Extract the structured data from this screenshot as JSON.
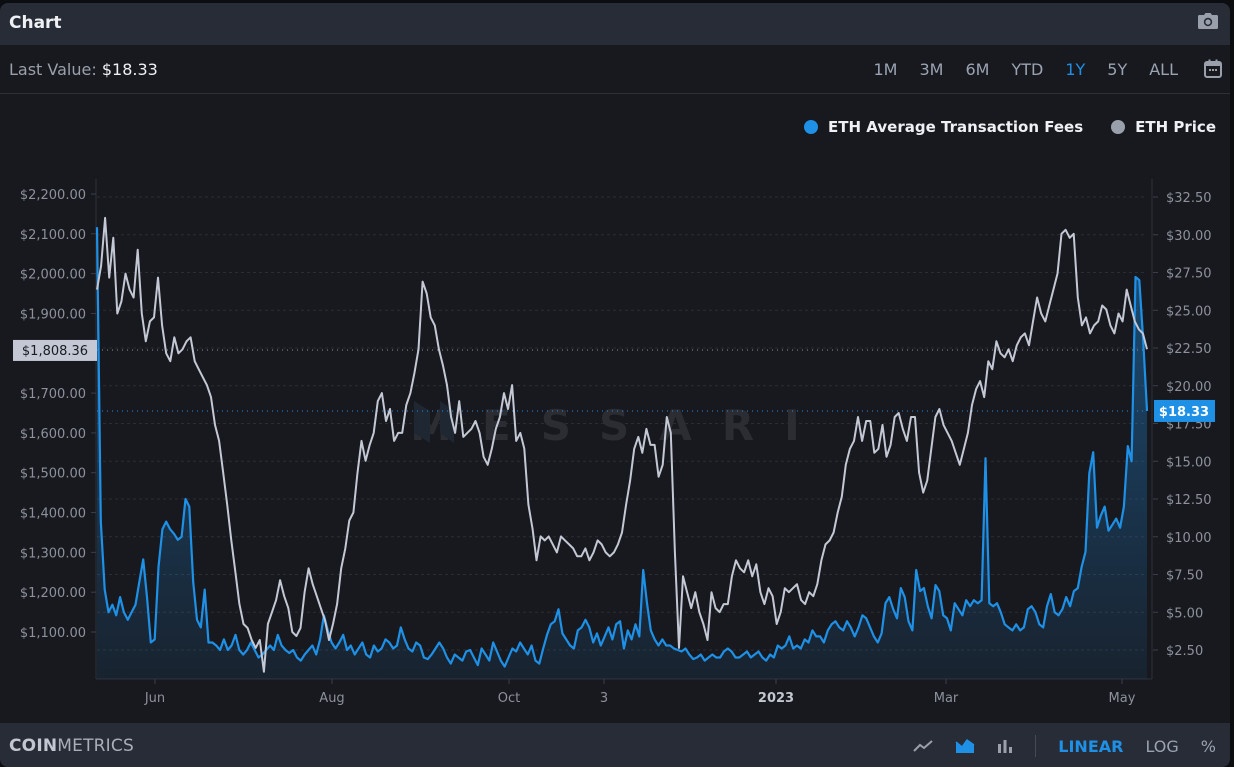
{
  "header": {
    "title": "Chart",
    "camera_icon": "camera-icon"
  },
  "subbar": {
    "last_value_label": "Last Value:",
    "last_value": "$18.33",
    "ranges": [
      "1M",
      "3M",
      "6M",
      "YTD",
      "1Y",
      "5Y",
      "ALL"
    ],
    "active_range": "1Y",
    "calendar_icon": "calendar-icon"
  },
  "footer": {
    "brand_bold": "COIN",
    "brand_light": "METRICS",
    "chart_types": [
      "line-chart-icon",
      "area-chart-icon",
      "bar-chart-icon"
    ],
    "active_chart_type": "area-chart-icon",
    "scale_modes": [
      "LINEAR",
      "LOG",
      "%"
    ],
    "active_scale": "LINEAR"
  },
  "colors": {
    "fees": "#1e90e6",
    "price": "#c3c8d4",
    "accent": "#1e90e6",
    "price_legend_dot": "#9aa0ab"
  },
  "watermark": "MESSARI",
  "chart_data": {
    "type": "line",
    "title": "",
    "legend": [
      "ETH Average Transaction Fees",
      "ETH Price"
    ],
    "legend_position": "top-right",
    "x_ticks": [
      "Jun",
      "Aug",
      "Oct",
      "3",
      "2023",
      "Mar",
      "May"
    ],
    "x_range": [
      "2022-05-21",
      "2023-05-10"
    ],
    "left_axis": {
      "series": "ETH Price",
      "ticks": [
        "$2,200.00",
        "$2,100.00",
        "$2,000.00",
        "$1,900.00",
        "$1,700.00",
        "$1,600.00",
        "$1,500.00",
        "$1,400.00",
        "$1,300.00",
        "$1,200.00",
        "$1,100.00"
      ],
      "range": [
        1000,
        2230
      ],
      "crosshair_label": "$1,808.36",
      "crosshair_value": 1808.36
    },
    "right_axis": {
      "series": "ETH Average Transaction Fees",
      "ticks": [
        "$32.50",
        "$30.00",
        "$27.50",
        "$25.00",
        "$22.50",
        "$20.00",
        "$17.50",
        "$15.00",
        "$12.50",
        "$10.00",
        "$7.50",
        "$5.00",
        "$2.50"
      ],
      "range": [
        0.6,
        33.5
      ],
      "last_label": "$18.33",
      "last_value": 18.33
    },
    "grid": true,
    "series": [
      {
        "name": "ETH Price",
        "axis": "left",
        "values": [
          1960,
          2020,
          2140,
          1990,
          2090,
          1900,
          1930,
          2000,
          1960,
          1940,
          2060,
          1900,
          1830,
          1880,
          1890,
          1990,
          1870,
          1800,
          1780,
          1840,
          1800,
          1810,
          1830,
          1840,
          1780,
          1760,
          1740,
          1720,
          1690,
          1620,
          1580,
          1500,
          1420,
          1330,
          1250,
          1170,
          1120,
          1110,
          1080,
          1060,
          1080,
          1000,
          1120,
          1150,
          1180,
          1230,
          1190,
          1160,
          1100,
          1090,
          1110,
          1200,
          1260,
          1220,
          1190,
          1160,
          1130,
          1080,
          1120,
          1170,
          1260,
          1310,
          1380,
          1400,
          1500,
          1580,
          1530,
          1570,
          1600,
          1680,
          1700,
          1630,
          1660,
          1580,
          1600,
          1600,
          1670,
          1700,
          1750,
          1810,
          1980,
          1950,
          1890,
          1870,
          1810,
          1770,
          1720,
          1640,
          1600,
          1680,
          1590,
          1600,
          1610,
          1630,
          1600,
          1540,
          1520,
          1560,
          1610,
          1640,
          1700,
          1660,
          1720,
          1580,
          1600,
          1560,
          1420,
          1360,
          1280,
          1340,
          1330,
          1340,
          1320,
          1300,
          1340,
          1330,
          1320,
          1310,
          1290,
          1290,
          1310,
          1280,
          1300,
          1330,
          1320,
          1300,
          1290,
          1300,
          1320,
          1350,
          1420,
          1480,
          1560,
          1590,
          1550,
          1610,
          1570,
          1570,
          1490,
          1520,
          1640,
          1600,
          1300,
          1060,
          1240,
          1200,
          1160,
          1200,
          1150,
          1120,
          1080,
          1200,
          1160,
          1150,
          1170,
          1170,
          1240,
          1280,
          1260,
          1250,
          1280,
          1240,
          1270,
          1200,
          1170,
          1210,
          1190,
          1120,
          1150,
          1210,
          1200,
          1210,
          1220,
          1180,
          1170,
          1200,
          1190,
          1220,
          1280,
          1320,
          1330,
          1350,
          1400,
          1440,
          1520,
          1560,
          1580,
          1640,
          1580,
          1630,
          1630,
          1550,
          1560,
          1620,
          1540,
          1570,
          1640,
          1650,
          1610,
          1580,
          1640,
          1640,
          1500,
          1450,
          1480,
          1560,
          1640,
          1660,
          1620,
          1600,
          1580,
          1550,
          1520,
          1560,
          1600,
          1670,
          1710,
          1730,
          1690,
          1780,
          1760,
          1830,
          1800,
          1790,
          1810,
          1780,
          1820,
          1840,
          1850,
          1820,
          1880,
          1940,
          1900,
          1880,
          1920,
          1960,
          2000,
          2100,
          2110,
          2090,
          2100,
          1940,
          1870,
          1890,
          1850,
          1870,
          1880,
          1920,
          1910,
          1870,
          1850,
          1900,
          1880,
          1960,
          1920,
          1880,
          1860,
          1850,
          1810
        ]
      },
      {
        "name": "ETH Average Transaction Fees",
        "axis": "right",
        "values": [
          30.5,
          11.0,
          6.5,
          5.0,
          5.5,
          4.8,
          6.0,
          5.0,
          4.5,
          5.0,
          5.5,
          7.0,
          8.5,
          6.0,
          3.0,
          3.2,
          8.0,
          10.5,
          11.0,
          10.5,
          10.2,
          9.8,
          10.0,
          12.5,
          12.0,
          7.0,
          4.5,
          4.0,
          6.5,
          3.0,
          3.0,
          2.8,
          2.5,
          3.2,
          2.5,
          2.8,
          3.5,
          2.5,
          2.2,
          2.5,
          3.0,
          2.5,
          2.0,
          2.2,
          2.5,
          2.8,
          2.5,
          3.5,
          2.8,
          2.5,
          2.3,
          2.5,
          2.0,
          1.8,
          2.2,
          2.5,
          2.8,
          2.2,
          3.2,
          4.8,
          3.8,
          3.0,
          2.6,
          3.0,
          3.5,
          2.5,
          2.8,
          2.2,
          2.6,
          3.0,
          2.2,
          2.0,
          2.8,
          2.4,
          2.6,
          3.2,
          3.0,
          2.6,
          2.8,
          4.0,
          3.2,
          2.6,
          2.4,
          3.0,
          2.8,
          2.0,
          1.9,
          2.2,
          2.6,
          3.0,
          2.6,
          2.0,
          1.6,
          2.2,
          2.0,
          1.8,
          2.4,
          2.5,
          2.0,
          1.5,
          2.6,
          2.2,
          1.8,
          3.0,
          2.4,
          1.8,
          1.4,
          2.0,
          2.6,
          2.4,
          3.0,
          2.6,
          2.2,
          2.8,
          1.8,
          1.6,
          2.6,
          3.5,
          4.2,
          4.4,
          5.2,
          3.6,
          3.2,
          2.8,
          2.6,
          3.8,
          4.0,
          4.5,
          4.0,
          3.0,
          3.6,
          2.8,
          3.4,
          4.0,
          3.2,
          4.2,
          4.4,
          2.6,
          3.8,
          3.2,
          4.2,
          3.4,
          7.8,
          5.6,
          3.8,
          3.2,
          2.8,
          3.2,
          2.8,
          2.8,
          2.6,
          2.5,
          2.4,
          2.6,
          2.2,
          1.9,
          2.0,
          2.2,
          1.8,
          2.0,
          2.2,
          2.0,
          2.0,
          2.4,
          2.6,
          2.4,
          2.0,
          2.0,
          2.2,
          2.4,
          2.0,
          2.2,
          2.4,
          2.0,
          1.8,
          2.2,
          2.0,
          2.8,
          2.6,
          2.8,
          3.4,
          2.6,
          2.8,
          2.6,
          3.2,
          3.0,
          3.8,
          3.4,
          3.4,
          3.0,
          3.8,
          4.2,
          4.4,
          4.0,
          3.8,
          4.4,
          4.0,
          3.4,
          4.0,
          4.8,
          4.6,
          4.0,
          3.4,
          3.0,
          3.6,
          5.6,
          6.0,
          5.2,
          4.6,
          6.6,
          6.0,
          4.4,
          3.8,
          7.8,
          6.4,
          6.6,
          5.4,
          4.6,
          6.8,
          6.4,
          4.8,
          4.6,
          3.8,
          5.6,
          5.2,
          4.8,
          5.8,
          5.4,
          5.8,
          5.6,
          5.8,
          15.2,
          5.6,
          5.4,
          5.6,
          5.0,
          4.2,
          4.0,
          3.8,
          4.2,
          3.8,
          4.0,
          5.2,
          5.4,
          5.0,
          4.2,
          4.0,
          5.4,
          6.2,
          5.0,
          4.8,
          5.2,
          6.0,
          5.4,
          6.4,
          6.6,
          8.0,
          9.0,
          14.2,
          15.6,
          10.6,
          11.4,
          12.0,
          10.4,
          10.8,
          11.2,
          10.6,
          12.0,
          16.0,
          15.0,
          27.2,
          27.0,
          23.0,
          18.33
        ]
      }
    ]
  }
}
